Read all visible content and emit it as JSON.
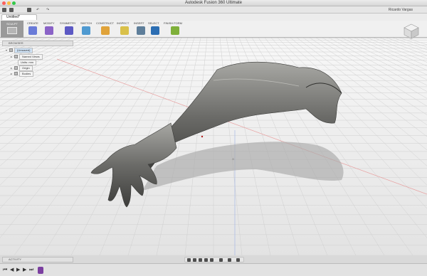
{
  "window": {
    "title": "Autodesk Fusion 360 Ultimate"
  },
  "quick_access": {
    "undo_hint": "↶",
    "redo_hint": "↷",
    "user_name": "Ricardo Vargas"
  },
  "document_tab": {
    "label": "Untitled*"
  },
  "ribbon": {
    "workspace": "SCULPT",
    "groups": [
      {
        "label": "CREATE",
        "color": "#6a7bd8"
      },
      {
        "label": "MODIFY",
        "color": "#8a63c7"
      },
      {
        "label": "SYMMETRY",
        "color": "#5c59c4"
      },
      {
        "label": "SKETCH",
        "color": "#4f9ad1"
      },
      {
        "label": "CONSTRUCT",
        "color": "#e0a33a"
      },
      {
        "label": "INSPECT",
        "color": "#d9c04a"
      },
      {
        "label": "INSERT",
        "color": "#5e7e9a"
      },
      {
        "label": "SELECT",
        "color": "#2c6eb3"
      },
      {
        "label": "FINISH FORM",
        "color": "#7fb03a"
      }
    ]
  },
  "browser": {
    "header": "BROWSER",
    "items": [
      {
        "label": "(Unsaved)",
        "icon": "document-icon"
      },
      {
        "label": "Named Views",
        "icon": "folder-icon"
      },
      {
        "label": "Units: mm",
        "icon": "document-icon"
      },
      {
        "label": "Origin",
        "icon": "folder-icon"
      },
      {
        "label": "Bodies",
        "icon": "folder-icon"
      }
    ]
  },
  "activity": {
    "label": "ACTIVITY"
  },
  "colors": {
    "canvas_top": "#f4f4f4",
    "canvas_bottom": "#e4e4e4",
    "model": "#7a7a78"
  }
}
